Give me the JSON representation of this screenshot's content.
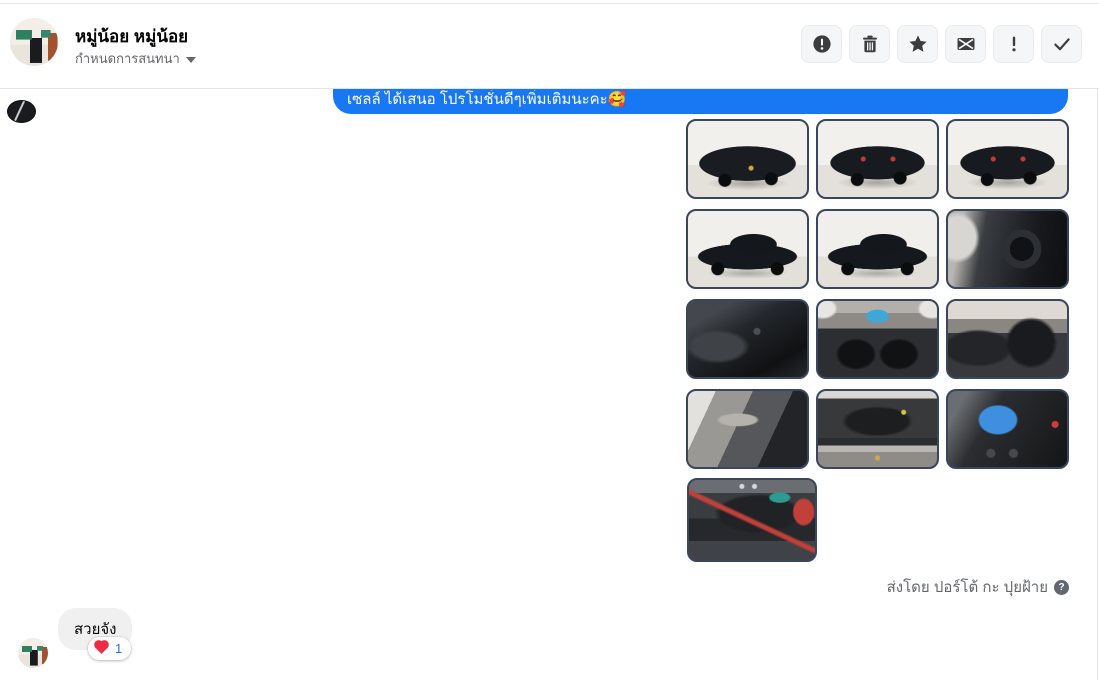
{
  "header": {
    "name": "หมู่น้อย หมู่น้อย",
    "subtitle": "กำหนดการสนทนา",
    "actions": [
      {
        "id": "report",
        "icon": "report-circle-icon"
      },
      {
        "id": "delete",
        "icon": "trash-icon"
      },
      {
        "id": "star",
        "icon": "star-icon"
      },
      {
        "id": "mark-unread",
        "icon": "envelope-x-icon"
      },
      {
        "id": "mark-important",
        "icon": "exclamation-icon"
      },
      {
        "id": "mark-done",
        "icon": "check-icon"
      }
    ]
  },
  "conversation": {
    "outgoing": {
      "text": "เซลล์ ได้เสนอ โปรโมชั่นดีๆเพิ่มเติมนะคะ🥰",
      "bubble_color": "#1877f2"
    },
    "photos": [
      {
        "kind": "truck-front",
        "label": "black pickup front three-quarter view"
      },
      {
        "kind": "truck-rear",
        "label": "black pickup rear left view"
      },
      {
        "kind": "truck-rear-right",
        "label": "black pickup rear right view"
      },
      {
        "kind": "truck-side",
        "label": "black pickup side view"
      },
      {
        "kind": "truck-side-front",
        "label": "black pickup front side view"
      },
      {
        "kind": "cockpit-wheel",
        "label": "steering wheel close-up"
      },
      {
        "kind": "console",
        "label": "gear shifter and console"
      },
      {
        "kind": "dashboard",
        "label": "full dashboard interior"
      },
      {
        "kind": "cabin-seats",
        "label": "cabin seats"
      },
      {
        "kind": "door-panel",
        "label": "door panel"
      },
      {
        "kind": "engine-bay",
        "label": "engine bay"
      },
      {
        "kind": "radio",
        "label": "radio display screen"
      },
      {
        "kind": "battery",
        "label": "car battery"
      }
    ],
    "sent_by": "ส่งโดย ปอร์โต้ กะ ปุยฝ้าย",
    "incoming": {
      "text": "สวยจัง",
      "reaction": "heart",
      "reaction_count": "1"
    }
  },
  "colors": {
    "accent_blue": "#1877f2",
    "incoming_bubble_gray": "#f0f0f0",
    "icon_dark": "#3b3d40",
    "photo_border": "#3a4660",
    "muted_text": "#65676b"
  }
}
